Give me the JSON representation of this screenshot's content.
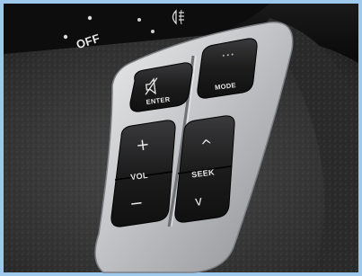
{
  "stalk": {
    "off_label": "OFF"
  },
  "controls": {
    "enter": {
      "label": "ENTER",
      "icon": "mute-speaker-icon"
    },
    "mode": {
      "label": "MODE",
      "dots": "• • •"
    },
    "vol": {
      "label": "VOL",
      "plus": "+",
      "minus": "−"
    },
    "seek": {
      "label": "SEEK",
      "up": "^",
      "down": "v"
    }
  },
  "colors": {
    "frame": "#9ec9ec",
    "leather": "#3a3a3a",
    "silver": "#c9cacc",
    "button": "#1e1e1f"
  }
}
